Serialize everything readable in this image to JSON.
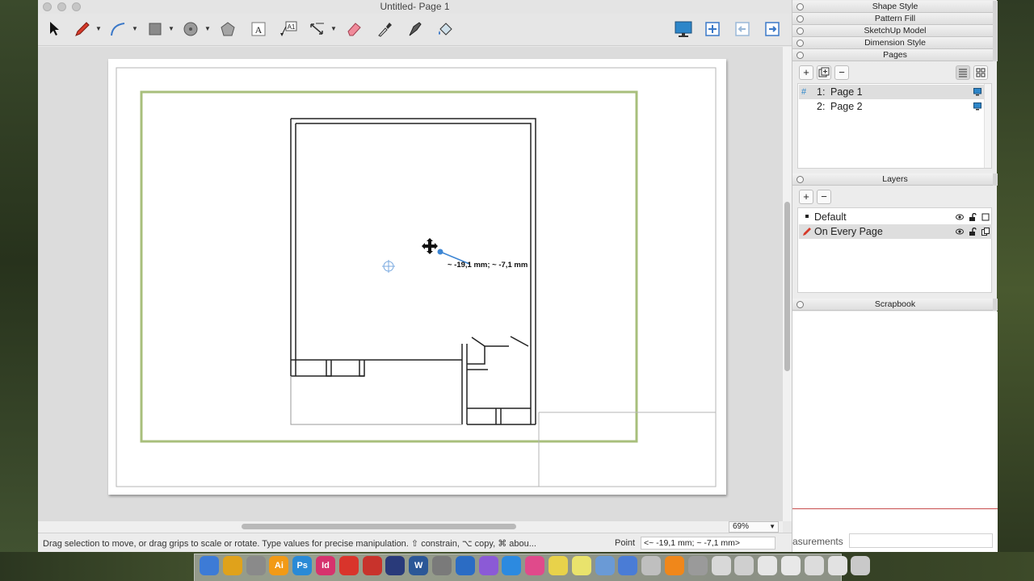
{
  "window": {
    "title": "Untitled- Page 1"
  },
  "toolbar": {
    "tools": [
      "select-arrow",
      "pencil",
      "arc",
      "rectangle",
      "circle",
      "polygon",
      "text",
      "label",
      "dimension",
      "eraser",
      "eyedropper",
      "pen",
      "paint-bucket"
    ],
    "right_tools": [
      "presentation",
      "add-page",
      "previous-page",
      "next-page"
    ]
  },
  "canvas": {
    "measurement_tooltip": "~ -19,1 mm; ~ -7,1 mm",
    "zoom": "69%"
  },
  "status": {
    "message": "Drag selection to move, or drag grips to scale or rotate. Type values for precise manipulation. ⇧ constrain, ⌥ copy, ⌘ abou...",
    "label": "Point",
    "value": "<~ -19,1 mm; ~ -7,1 mm>"
  },
  "tray": {
    "panels": {
      "shape_style": "Shape Style",
      "pattern_fill": "Pattern Fill",
      "sketchup_model": "SketchUp Model",
      "dimension_style": "Dimension Style",
      "pages": "Pages",
      "layers": "Layers",
      "scrapbook": "Scrapbook"
    },
    "pages": [
      {
        "number": "1:",
        "name": "Page 1",
        "selected": true
      },
      {
        "number": "2:",
        "name": "Page 2",
        "selected": false
      }
    ],
    "layers": [
      {
        "name": "Default",
        "selected": false
      },
      {
        "name": "On Every Page",
        "selected": true
      }
    ],
    "measurements_label": "asurements"
  },
  "dock": {
    "apps": [
      "Finder",
      "Chrome",
      "Launchpad",
      "Ai",
      "Ps",
      "Id",
      "Acrobat",
      "PDF",
      "Camera",
      "W",
      "System Prefs",
      "Outlook",
      "Star",
      "App Store",
      "iTunes",
      "Stickies",
      "Notes",
      "Preview",
      "Keynote",
      "Images",
      "VLC",
      "Finder2",
      "Folder",
      "Scanner",
      "Docs",
      "Files",
      "Stack",
      "Stack2",
      "Trash"
    ],
    "colors": [
      "#3d7bd6",
      "#e0a21b",
      "#8a8a8a",
      "#f29a16",
      "#2a8ad6",
      "#d6326d",
      "#d9342b",
      "#c8332c",
      "#293a7a",
      "#2b5797",
      "#7a7a7a",
      "#2b6cc4",
      "#8b5ad6",
      "#2c8ae0",
      "#e04a8b",
      "#e8d24a",
      "#e9e36c",
      "#6a9ad6",
      "#4a7cd6",
      "#bfbfbf",
      "#f0871a",
      "#9a9a9a",
      "#d8d8d8",
      "#cfcfcf",
      "#e6e6e6",
      "#e8e8e8",
      "#dcdcdc",
      "#e2e2e2",
      "#c9c9c9"
    ]
  }
}
